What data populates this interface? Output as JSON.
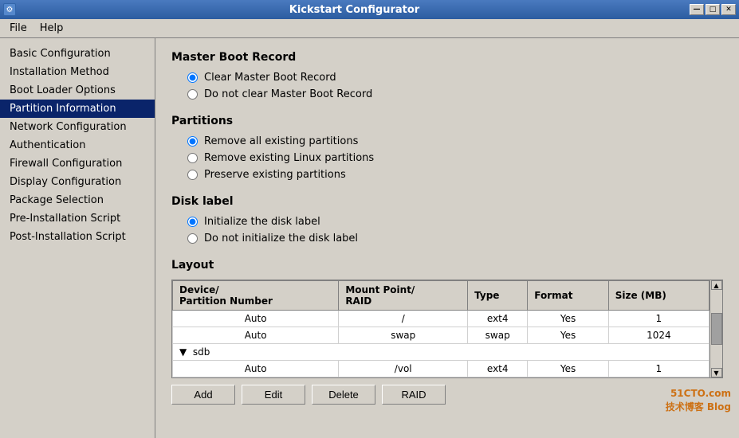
{
  "window": {
    "title": "Kickstart Configurator",
    "icon": "🔧",
    "controls": {
      "minimize": "—",
      "restore": "□",
      "close": "✕"
    }
  },
  "menu": {
    "items": [
      "File",
      "Help"
    ]
  },
  "sidebar": {
    "items": [
      {
        "id": "basic-configuration",
        "label": "Basic Configuration",
        "active": false
      },
      {
        "id": "installation-method",
        "label": "Installation Method",
        "active": false
      },
      {
        "id": "boot-loader-options",
        "label": "Boot Loader Options",
        "active": false
      },
      {
        "id": "partition-information",
        "label": "Partition Information",
        "active": true
      },
      {
        "id": "network-configuration",
        "label": "Network Configuration",
        "active": false
      },
      {
        "id": "authentication",
        "label": "Authentication",
        "active": false
      },
      {
        "id": "firewall-configuration",
        "label": "Firewall Configuration",
        "active": false
      },
      {
        "id": "display-configuration",
        "label": "Display Configuration",
        "active": false
      },
      {
        "id": "package-selection",
        "label": "Package Selection",
        "active": false
      },
      {
        "id": "pre-installation-script",
        "label": "Pre-Installation Script",
        "active": false
      },
      {
        "id": "post-installation-script",
        "label": "Post-Installation Script",
        "active": false
      }
    ]
  },
  "content": {
    "master_boot_record": {
      "title": "Master Boot Record",
      "options": [
        {
          "id": "clear-mbr",
          "label": "Clear Master Boot Record",
          "checked": true
        },
        {
          "id": "no-clear-mbr",
          "label": "Do not clear Master Boot Record",
          "checked": false
        }
      ]
    },
    "partitions": {
      "title": "Partitions",
      "options": [
        {
          "id": "remove-all",
          "label": "Remove all existing partitions",
          "checked": true
        },
        {
          "id": "remove-linux",
          "label": "Remove existing Linux partitions",
          "checked": false
        },
        {
          "id": "preserve",
          "label": "Preserve existing partitions",
          "checked": false
        }
      ]
    },
    "disk_label": {
      "title": "Disk label",
      "options": [
        {
          "id": "init-disk",
          "label": "Initialize the disk label",
          "checked": true
        },
        {
          "id": "no-init-disk",
          "label": "Do not initialize the disk label",
          "checked": false
        }
      ]
    },
    "layout": {
      "title": "Layout",
      "columns": [
        "Device/\nPartition Number",
        "Mount Point/\nRAID",
        "Type",
        "Format",
        "Size (MB)"
      ],
      "column_labels": [
        "Device/ Partition Number",
        "Mount Point/ RAID",
        "Type",
        "Format",
        "Size (MB)"
      ],
      "rows": [
        {
          "type": "data",
          "device": "Auto",
          "mount": "/",
          "fstype": "ext4",
          "format": "Yes",
          "size": "1"
        },
        {
          "type": "data",
          "device": "Auto",
          "mount": "swap",
          "fstype": "swap",
          "format": "Yes",
          "size": "1024"
        },
        {
          "type": "group",
          "label": "▼  sdb"
        },
        {
          "type": "data",
          "device": "Auto",
          "mount": "/vol",
          "fstype": "ext4",
          "format": "Yes",
          "size": "1"
        }
      ]
    },
    "buttons": {
      "add": "Add",
      "edit": "Edit",
      "delete": "Delete",
      "raid": "RAID"
    }
  },
  "watermark": {
    "line1": "51CTO.com",
    "line2": "技术博客  Blog"
  }
}
